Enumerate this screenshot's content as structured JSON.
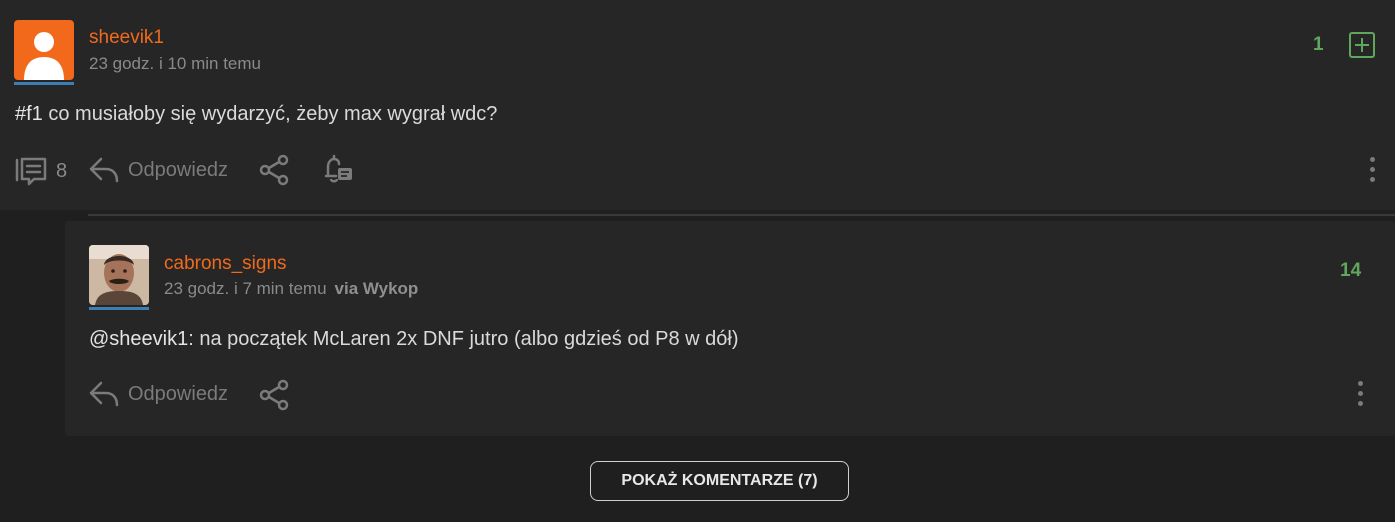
{
  "post": {
    "author": "sheevik1",
    "time": "23 godz. i 10 min temu",
    "tag": "#f1",
    "text": " co musiałoby się wydarzyć, żeby max wygrał wdc?",
    "votes": "1",
    "comments_count": "8",
    "reply_label": "Odpowiedz"
  },
  "comment": {
    "author": "cabrons_signs",
    "time": "23 godz. i 7 min temu",
    "via": "via Wykop",
    "mention": "@sheevik1",
    "text": ": na początek McLaren 2x DNF jutro (albo gdzieś od P8 w dół)",
    "votes": "14",
    "reply_label": "Odpowiedz"
  },
  "show_comments_label": "POKAŻ KOMENTARZE (7)",
  "colors": {
    "accent_author": "#f06a1d",
    "vote_green": "#5fa75c",
    "avatar_bar": "#3d7fb5"
  },
  "icons": [
    "user-avatar-icon",
    "plus-square-icon",
    "comments-icon",
    "reply-icon",
    "share-icon",
    "bell-icon",
    "more-vertical-icon"
  ]
}
